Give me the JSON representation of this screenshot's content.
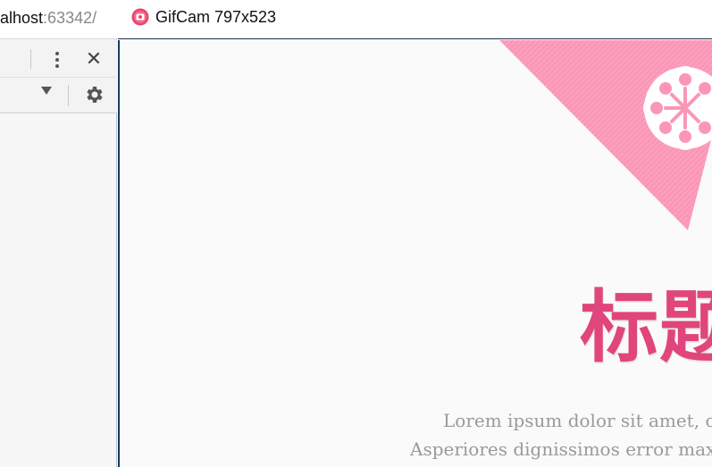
{
  "browser": {
    "address_host": "alhost",
    "address_port": ":63342/"
  },
  "gifcam": {
    "title": "GifCam 797x523"
  },
  "page": {
    "heading": "标题",
    "paragraph_line1": "Lorem ipsum dolor sit amet, co",
    "paragraph_line2": "Asperiores dignissimos error maxir"
  },
  "colors": {
    "accent_pink": "#e0457b",
    "banner_pink": "#fb97b6"
  }
}
